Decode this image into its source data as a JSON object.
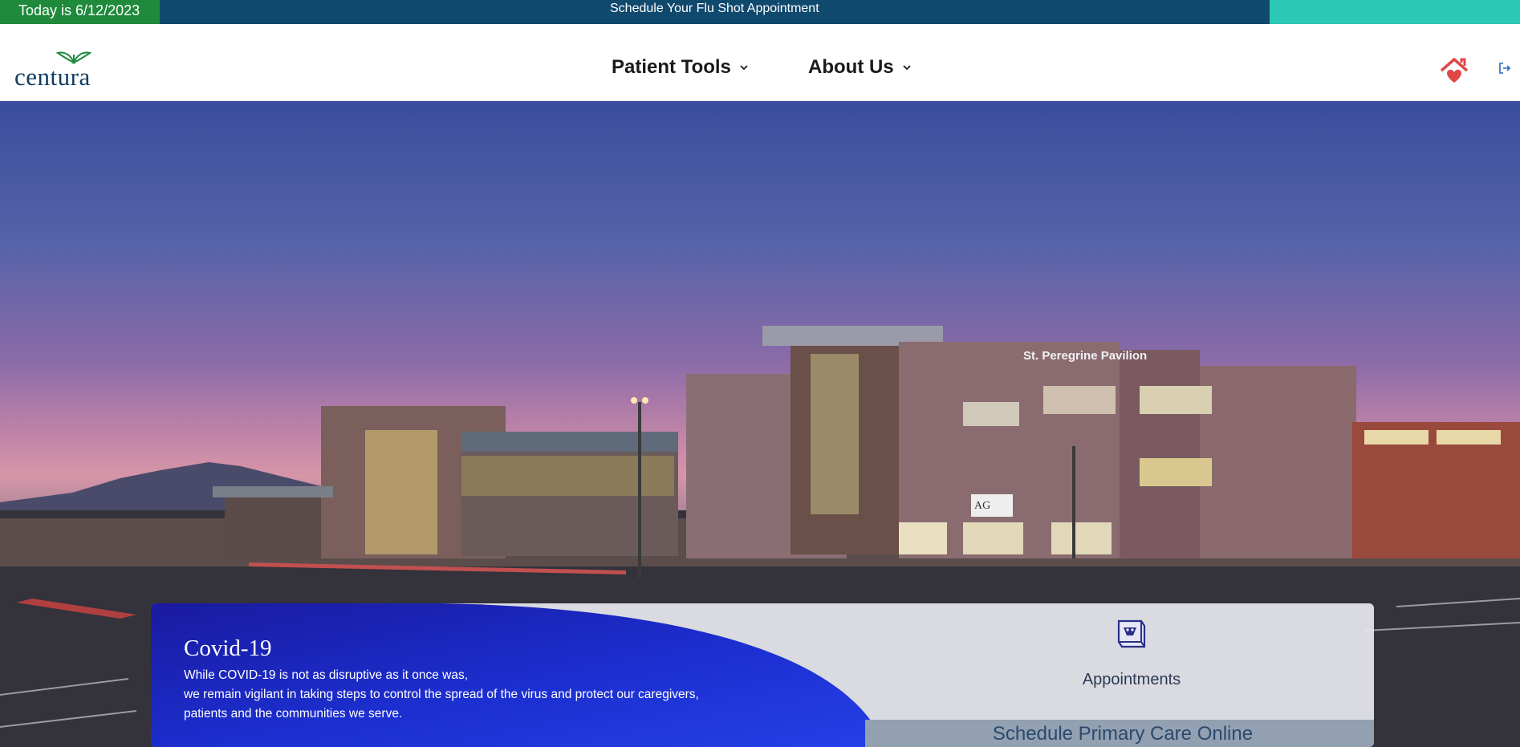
{
  "top_banner": {
    "date_text": "Today is 6/12/2023",
    "flu_shot_link": "Schedule Your Flu Shot Appointment",
    "colors": {
      "banner": "#10496e",
      "date_box": "#1f8a3c",
      "accent": "#2ac8b5"
    }
  },
  "header": {
    "logo_text": "centura",
    "nav": [
      {
        "label": "Patient Tools"
      },
      {
        "label": "About Us"
      }
    ],
    "icons": {
      "home": "home-heart-icon",
      "logout": "logout-icon"
    }
  },
  "hero": {
    "building_sign": "St. Peregrine Pavilion",
    "building_logo": "AG"
  },
  "covid_card": {
    "title": "Covid-19",
    "lines": [
      "While COVID-19 is not as disruptive as it once was,",
      "we remain vigilant in taking steps to control the spread of the virus and protect our caregivers,",
      "patients and the communities we serve."
    ],
    "appointments_label": "Appointments",
    "appointments_icon": "appointment-book-icon",
    "schedule_label": "Schedule Primary Care Online"
  }
}
